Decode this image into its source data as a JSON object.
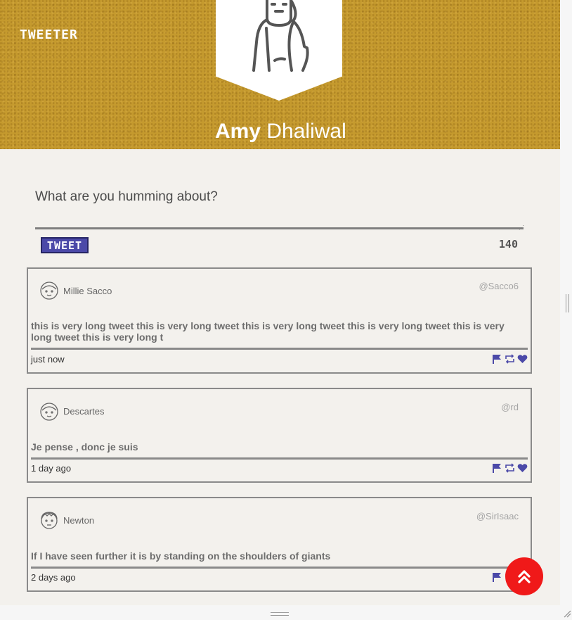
{
  "brand": "TWEETER",
  "profile": {
    "first_name": "Amy",
    "last_name": "Dhaliwal"
  },
  "compose": {
    "placeholder": "What are you humming about?",
    "tweet_button_label": "TWEET",
    "char_remaining": "140"
  },
  "tweets": [
    {
      "author": "Millie Sacco",
      "handle": "@Sacco6",
      "text": "this is very long tweet this is very long tweet this is very long tweet this is very long tweet this is very long tweet this is very long t",
      "time": "just now"
    },
    {
      "author": "Descartes",
      "handle": "@rd",
      "text": "Je pense , donc je suis",
      "time": "1 day ago"
    },
    {
      "author": "Newton",
      "handle": "@SirIsaac",
      "text": "If I have seen further it is by standing on the shoulders of giants",
      "time": "2 days ago"
    }
  ],
  "icons": {
    "flag": "flag-icon",
    "retweet": "retweet-icon",
    "like": "heart-icon",
    "scroll_top": "double-chevron-up-icon"
  },
  "colors": {
    "header_bg": "#c59a2e",
    "accent": "#4b49a8",
    "scroll_button": "#f01919"
  }
}
